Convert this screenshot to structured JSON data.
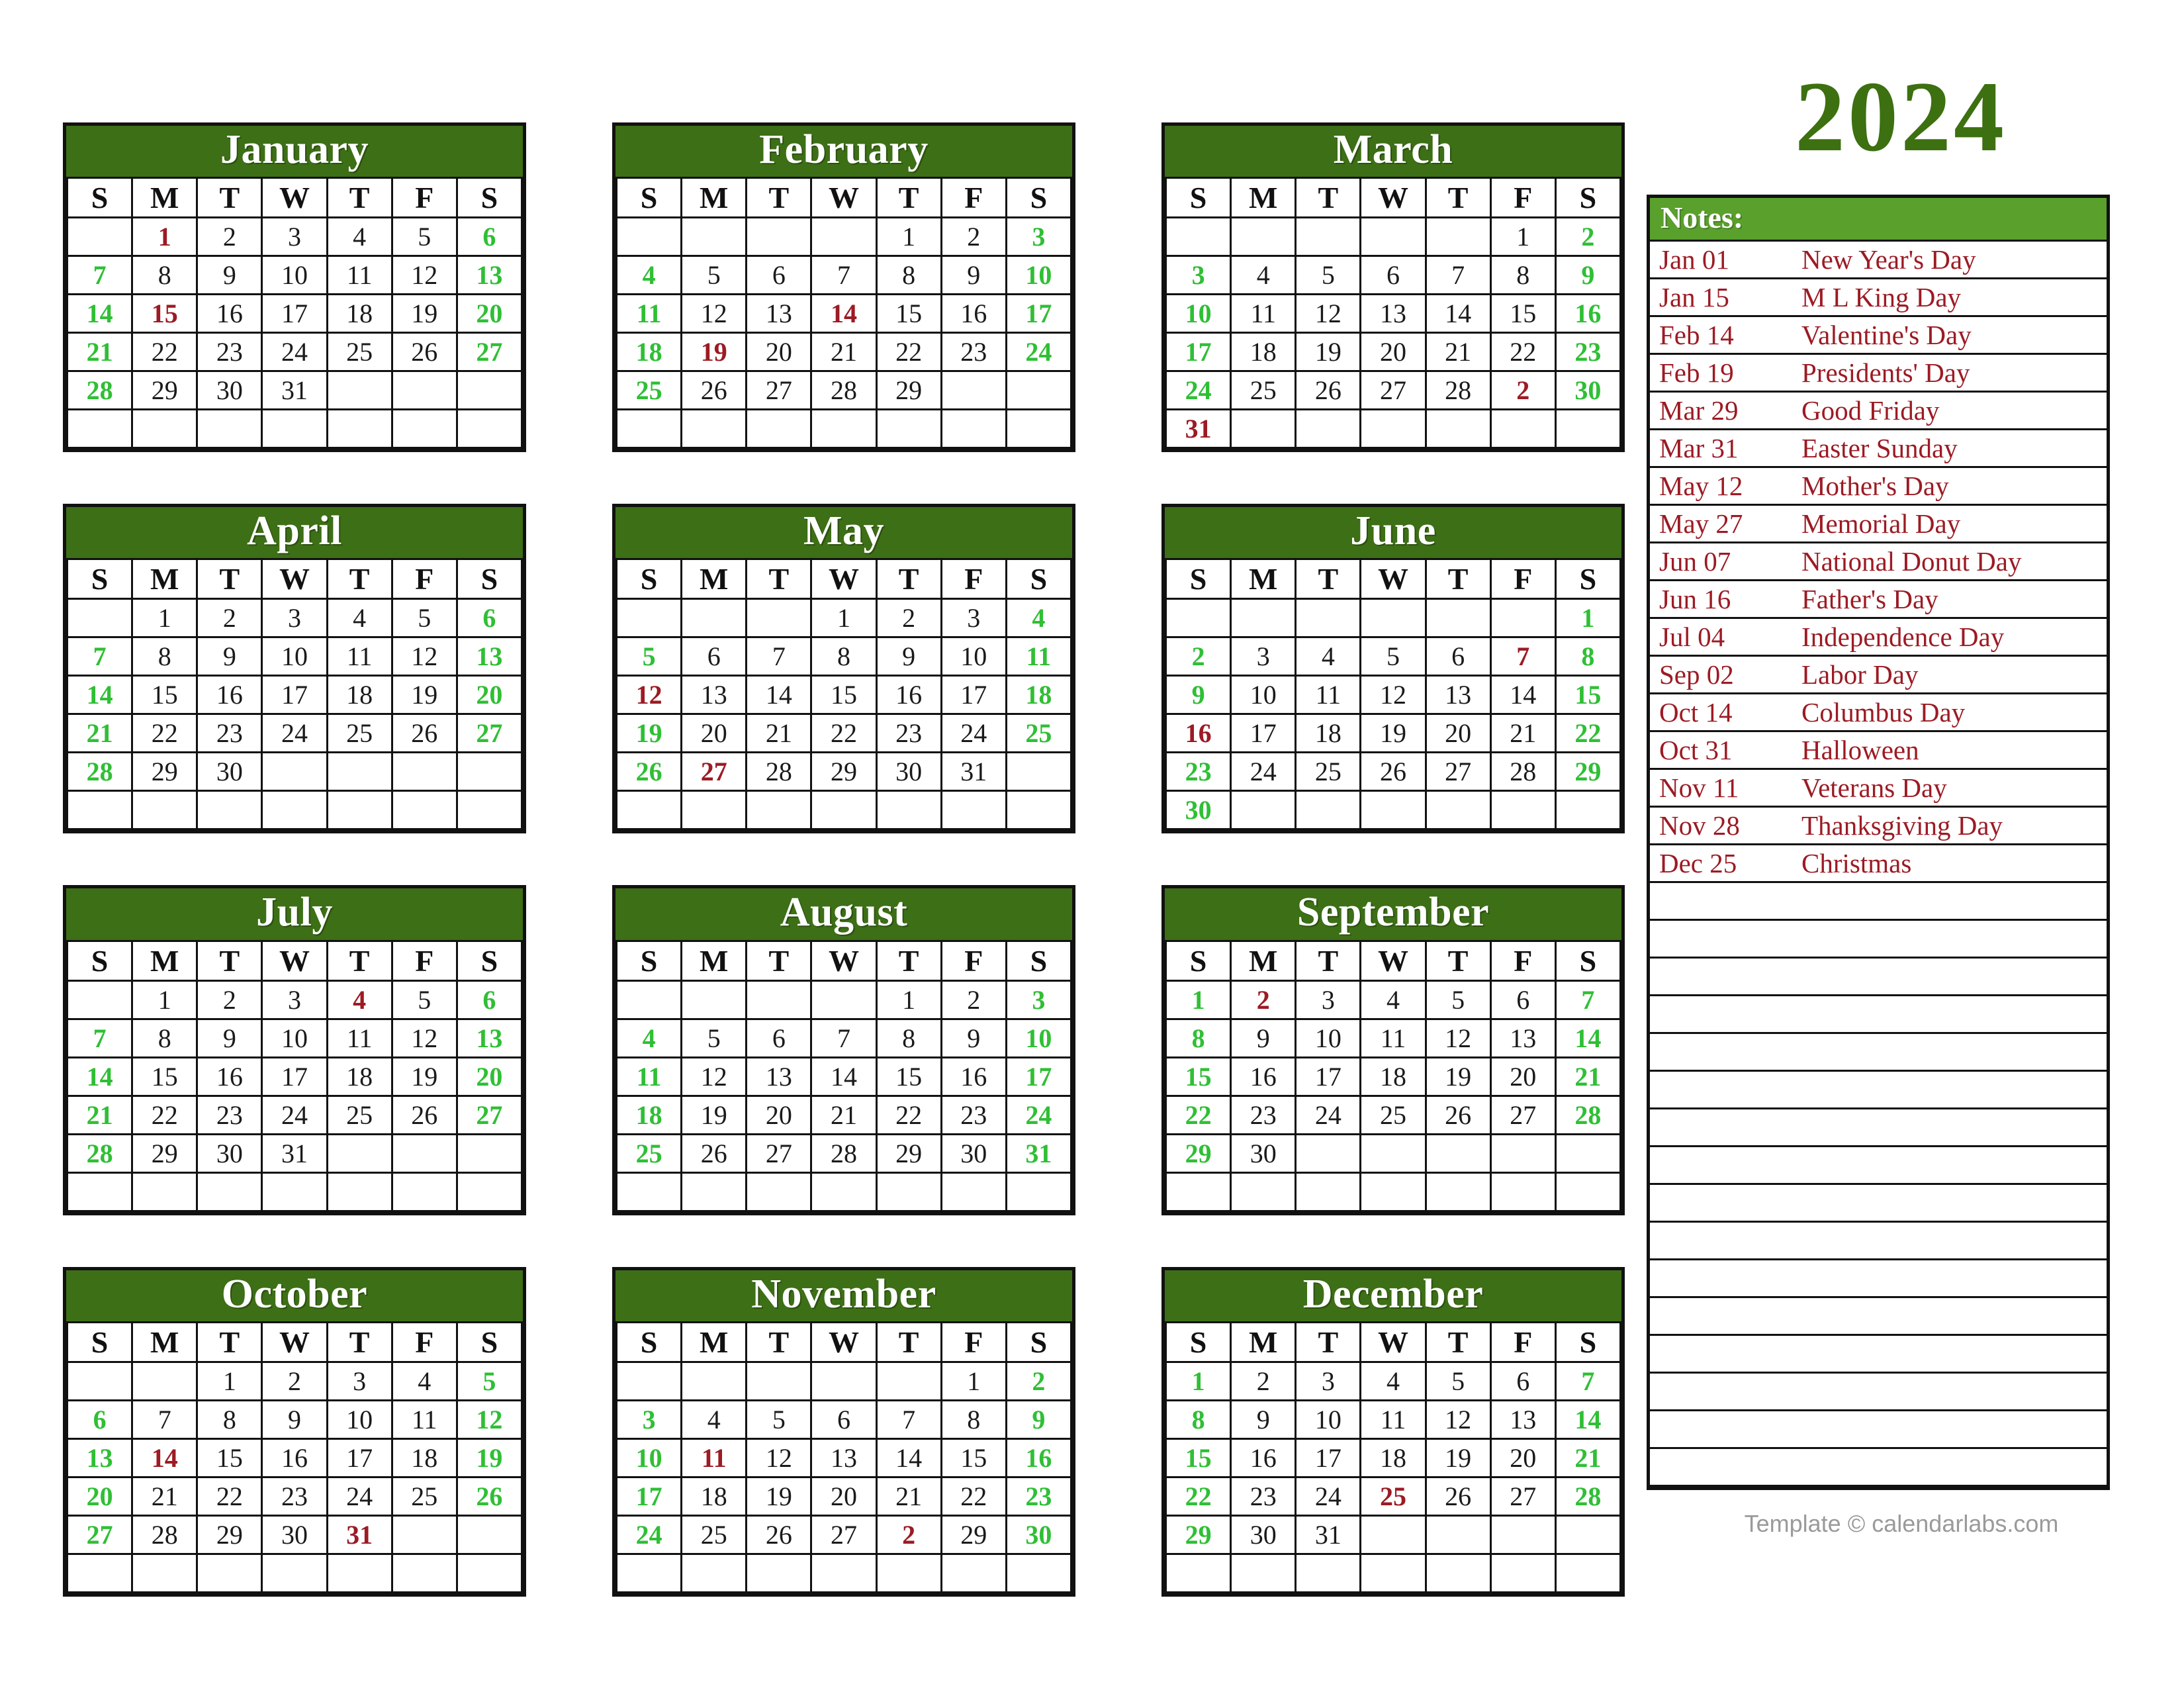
{
  "year_title": "2024",
  "footer": "Template © calendarlabs.com",
  "colors": {
    "month_header_green": "#3d6f16",
    "notes_header_green": "#5aa02c",
    "year_green": "#3d7010",
    "weekend_green": "#2fbf35",
    "holiday_red": "#9c1b24",
    "grid_black": "#111111"
  },
  "weekday_headers": [
    "S",
    "M",
    "T",
    "W",
    "T",
    "F",
    "S"
  ],
  "notes": {
    "header": "Notes:",
    "blank_rows": 16,
    "items": [
      {
        "date": "Jan 01",
        "label": "New Year's Day"
      },
      {
        "date": "Jan 15",
        "label": "M L King Day"
      },
      {
        "date": "Feb 14",
        "label": "Valentine's Day"
      },
      {
        "date": "Feb 19",
        "label": "Presidents' Day"
      },
      {
        "date": "Mar 29",
        "label": "Good Friday"
      },
      {
        "date": "Mar 31",
        "label": "Easter Sunday"
      },
      {
        "date": "May 12",
        "label": "Mother's Day"
      },
      {
        "date": "May 27",
        "label": "Memorial Day"
      },
      {
        "date": "Jun 07",
        "label": "National Donut Day"
      },
      {
        "date": "Jun 16",
        "label": "Father's Day"
      },
      {
        "date": "Jul 04",
        "label": "Independence Day"
      },
      {
        "date": "Sep 02",
        "label": "Labor Day"
      },
      {
        "date": "Oct 14",
        "label": "Columbus Day"
      },
      {
        "date": "Oct 31",
        "label": "Halloween"
      },
      {
        "date": "Nov 11",
        "label": "Veterans Day"
      },
      {
        "date": "Nov 28",
        "label": "Thanksgiving Day"
      },
      {
        "date": "Dec 25",
        "label": "Christmas"
      }
    ]
  },
  "months": [
    {
      "name": "January",
      "weeks": [
        [
          "",
          {
            "d": "1",
            "t": "holiday"
          },
          "2",
          "3",
          "4",
          "5",
          {
            "d": "6",
            "t": "weekend"
          }
        ],
        [
          {
            "d": "7",
            "t": "weekend"
          },
          "8",
          "9",
          "10",
          "11",
          "12",
          {
            "d": "13",
            "t": "weekend"
          }
        ],
        [
          {
            "d": "14",
            "t": "weekend"
          },
          {
            "d": "15",
            "t": "holiday"
          },
          "16",
          "17",
          "18",
          "19",
          {
            "d": "20",
            "t": "weekend"
          }
        ],
        [
          {
            "d": "21",
            "t": "weekend"
          },
          "22",
          "23",
          "24",
          "25",
          "26",
          {
            "d": "27",
            "t": "weekend"
          }
        ],
        [
          {
            "d": "28",
            "t": "weekend"
          },
          "29",
          "30",
          "31",
          "",
          "",
          ""
        ],
        [
          "",
          "",
          "",
          "",
          "",
          "",
          ""
        ]
      ]
    },
    {
      "name": "February",
      "weeks": [
        [
          "",
          "",
          "",
          "",
          "1",
          "2",
          {
            "d": "3",
            "t": "weekend"
          }
        ],
        [
          {
            "d": "4",
            "t": "weekend"
          },
          "5",
          "6",
          "7",
          "8",
          "9",
          {
            "d": "10",
            "t": "weekend"
          }
        ],
        [
          {
            "d": "11",
            "t": "weekend"
          },
          "12",
          "13",
          {
            "d": "14",
            "t": "holiday"
          },
          "15",
          "16",
          {
            "d": "17",
            "t": "weekend"
          }
        ],
        [
          {
            "d": "18",
            "t": "weekend"
          },
          {
            "d": "19",
            "t": "holiday"
          },
          "20",
          "21",
          "22",
          "23",
          {
            "d": "24",
            "t": "weekend"
          }
        ],
        [
          {
            "d": "25",
            "t": "weekend"
          },
          "26",
          "27",
          "28",
          "29",
          "",
          ""
        ],
        [
          "",
          "",
          "",
          "",
          "",
          "",
          ""
        ]
      ]
    },
    {
      "name": "March",
      "weeks": [
        [
          "",
          "",
          "",
          "",
          "",
          "1",
          {
            "d": "2",
            "t": "weekend"
          }
        ],
        [
          {
            "d": "3",
            "t": "weekend"
          },
          "4",
          "5",
          "6",
          "7",
          "8",
          {
            "d": "9",
            "t": "weekend"
          }
        ],
        [
          {
            "d": "10",
            "t": "weekend"
          },
          "11",
          "12",
          "13",
          "14",
          "15",
          {
            "d": "16",
            "t": "weekend"
          }
        ],
        [
          {
            "d": "17",
            "t": "weekend"
          },
          "18",
          "19",
          "20",
          "21",
          "22",
          {
            "d": "23",
            "t": "weekend"
          }
        ],
        [
          {
            "d": "24",
            "t": "weekend"
          },
          "25",
          "26",
          "27",
          "28",
          {
            "d": "2",
            "t": "holiday"
          },
          {
            "d": "30",
            "t": "weekend"
          }
        ],
        [
          {
            "d": "31",
            "t": "holiday"
          },
          "",
          "",
          "",
          "",
          "",
          ""
        ]
      ]
    },
    {
      "name": "April",
      "weeks": [
        [
          "",
          "1",
          "2",
          "3",
          "4",
          "5",
          {
            "d": "6",
            "t": "weekend"
          }
        ],
        [
          {
            "d": "7",
            "t": "weekend"
          },
          "8",
          "9",
          "10",
          "11",
          "12",
          {
            "d": "13",
            "t": "weekend"
          }
        ],
        [
          {
            "d": "14",
            "t": "weekend"
          },
          "15",
          "16",
          "17",
          "18",
          "19",
          {
            "d": "20",
            "t": "weekend"
          }
        ],
        [
          {
            "d": "21",
            "t": "weekend"
          },
          "22",
          "23",
          "24",
          "25",
          "26",
          {
            "d": "27",
            "t": "weekend"
          }
        ],
        [
          {
            "d": "28",
            "t": "weekend"
          },
          "29",
          "30",
          "",
          "",
          "",
          ""
        ],
        [
          "",
          "",
          "",
          "",
          "",
          "",
          ""
        ]
      ]
    },
    {
      "name": "May",
      "weeks": [
        [
          "",
          "",
          "",
          "1",
          "2",
          "3",
          {
            "d": "4",
            "t": "weekend"
          }
        ],
        [
          {
            "d": "5",
            "t": "weekend"
          },
          "6",
          "7",
          "8",
          "9",
          "10",
          {
            "d": "11",
            "t": "weekend"
          }
        ],
        [
          {
            "d": "12",
            "t": "holiday"
          },
          "13",
          "14",
          "15",
          "16",
          "17",
          {
            "d": "18",
            "t": "weekend"
          }
        ],
        [
          {
            "d": "19",
            "t": "weekend"
          },
          "20",
          "21",
          "22",
          "23",
          "24",
          {
            "d": "25",
            "t": "weekend"
          }
        ],
        [
          {
            "d": "26",
            "t": "weekend"
          },
          {
            "d": "27",
            "t": "holiday"
          },
          "28",
          "29",
          "30",
          "31",
          ""
        ],
        [
          "",
          "",
          "",
          "",
          "",
          "",
          ""
        ]
      ]
    },
    {
      "name": "June",
      "weeks": [
        [
          "",
          "",
          "",
          "",
          "",
          "",
          {
            "d": "1",
            "t": "weekend"
          }
        ],
        [
          {
            "d": "2",
            "t": "weekend"
          },
          "3",
          "4",
          "5",
          "6",
          {
            "d": "7",
            "t": "holiday"
          },
          {
            "d": "8",
            "t": "weekend"
          }
        ],
        [
          {
            "d": "9",
            "t": "weekend"
          },
          "10",
          "11",
          "12",
          "13",
          "14",
          {
            "d": "15",
            "t": "weekend"
          }
        ],
        [
          {
            "d": "16",
            "t": "holiday"
          },
          "17",
          "18",
          "19",
          "20",
          "21",
          {
            "d": "22",
            "t": "weekend"
          }
        ],
        [
          {
            "d": "23",
            "t": "weekend"
          },
          "24",
          "25",
          "26",
          "27",
          "28",
          {
            "d": "29",
            "t": "weekend"
          }
        ],
        [
          {
            "d": "30",
            "t": "weekend"
          },
          "",
          "",
          "",
          "",
          "",
          ""
        ]
      ]
    },
    {
      "name": "July",
      "weeks": [
        [
          "",
          "1",
          "2",
          "3",
          {
            "d": "4",
            "t": "holiday"
          },
          "5",
          {
            "d": "6",
            "t": "weekend"
          }
        ],
        [
          {
            "d": "7",
            "t": "weekend"
          },
          "8",
          "9",
          "10",
          "11",
          "12",
          {
            "d": "13",
            "t": "weekend"
          }
        ],
        [
          {
            "d": "14",
            "t": "weekend"
          },
          "15",
          "16",
          "17",
          "18",
          "19",
          {
            "d": "20",
            "t": "weekend"
          }
        ],
        [
          {
            "d": "21",
            "t": "weekend"
          },
          "22",
          "23",
          "24",
          "25",
          "26",
          {
            "d": "27",
            "t": "weekend"
          }
        ],
        [
          {
            "d": "28",
            "t": "weekend"
          },
          "29",
          "30",
          "31",
          "",
          "",
          ""
        ],
        [
          "",
          "",
          "",
          "",
          "",
          "",
          ""
        ]
      ]
    },
    {
      "name": "August",
      "weeks": [
        [
          "",
          "",
          "",
          "",
          "1",
          "2",
          {
            "d": "3",
            "t": "weekend"
          }
        ],
        [
          {
            "d": "4",
            "t": "weekend"
          },
          "5",
          "6",
          "7",
          "8",
          "9",
          {
            "d": "10",
            "t": "weekend"
          }
        ],
        [
          {
            "d": "11",
            "t": "weekend"
          },
          "12",
          "13",
          "14",
          "15",
          "16",
          {
            "d": "17",
            "t": "weekend"
          }
        ],
        [
          {
            "d": "18",
            "t": "weekend"
          },
          "19",
          "20",
          "21",
          "22",
          "23",
          {
            "d": "24",
            "t": "weekend"
          }
        ],
        [
          {
            "d": "25",
            "t": "weekend"
          },
          "26",
          "27",
          "28",
          "29",
          "30",
          {
            "d": "31",
            "t": "weekend"
          }
        ],
        [
          "",
          "",
          "",
          "",
          "",
          "",
          ""
        ]
      ]
    },
    {
      "name": "September",
      "weeks": [
        [
          {
            "d": "1",
            "t": "weekend"
          },
          {
            "d": "2",
            "t": "holiday"
          },
          "3",
          "4",
          "5",
          "6",
          {
            "d": "7",
            "t": "weekend"
          }
        ],
        [
          {
            "d": "8",
            "t": "weekend"
          },
          "9",
          "10",
          "11",
          "12",
          "13",
          {
            "d": "14",
            "t": "weekend"
          }
        ],
        [
          {
            "d": "15",
            "t": "weekend"
          },
          "16",
          "17",
          "18",
          "19",
          "20",
          {
            "d": "21",
            "t": "weekend"
          }
        ],
        [
          {
            "d": "22",
            "t": "weekend"
          },
          "23",
          "24",
          "25",
          "26",
          "27",
          {
            "d": "28",
            "t": "weekend"
          }
        ],
        [
          {
            "d": "29",
            "t": "weekend"
          },
          "30",
          "",
          "",
          "",
          "",
          ""
        ],
        [
          "",
          "",
          "",
          "",
          "",
          "",
          ""
        ]
      ]
    },
    {
      "name": "October",
      "weeks": [
        [
          "",
          "",
          "1",
          "2",
          "3",
          "4",
          {
            "d": "5",
            "t": "weekend"
          }
        ],
        [
          {
            "d": "6",
            "t": "weekend"
          },
          "7",
          "8",
          "9",
          "10",
          "11",
          {
            "d": "12",
            "t": "weekend"
          }
        ],
        [
          {
            "d": "13",
            "t": "weekend"
          },
          {
            "d": "14",
            "t": "holiday"
          },
          "15",
          "16",
          "17",
          "18",
          {
            "d": "19",
            "t": "weekend"
          }
        ],
        [
          {
            "d": "20",
            "t": "weekend"
          },
          "21",
          "22",
          "23",
          "24",
          "25",
          {
            "d": "26",
            "t": "weekend"
          }
        ],
        [
          {
            "d": "27",
            "t": "weekend"
          },
          "28",
          "29",
          "30",
          {
            "d": "31",
            "t": "holiday"
          },
          "",
          ""
        ],
        [
          "",
          "",
          "",
          "",
          "",
          "",
          ""
        ]
      ]
    },
    {
      "name": "November",
      "weeks": [
        [
          "",
          "",
          "",
          "",
          "",
          "1",
          {
            "d": "2",
            "t": "weekend"
          }
        ],
        [
          {
            "d": "3",
            "t": "weekend"
          },
          "4",
          "5",
          "6",
          "7",
          "8",
          {
            "d": "9",
            "t": "weekend"
          }
        ],
        [
          {
            "d": "10",
            "t": "weekend"
          },
          {
            "d": "11",
            "t": "holiday"
          },
          "12",
          "13",
          "14",
          "15",
          {
            "d": "16",
            "t": "weekend"
          }
        ],
        [
          {
            "d": "17",
            "t": "weekend"
          },
          "18",
          "19",
          "20",
          "21",
          "22",
          {
            "d": "23",
            "t": "weekend"
          }
        ],
        [
          {
            "d": "24",
            "t": "weekend"
          },
          "25",
          "26",
          "27",
          {
            "d": "2",
            "t": "holiday"
          },
          "29",
          {
            "d": "30",
            "t": "weekend"
          }
        ],
        [
          "",
          "",
          "",
          "",
          "",
          "",
          ""
        ]
      ]
    },
    {
      "name": "December",
      "weeks": [
        [
          {
            "d": "1",
            "t": "weekend"
          },
          "2",
          "3",
          "4",
          "5",
          "6",
          {
            "d": "7",
            "t": "weekend"
          }
        ],
        [
          {
            "d": "8",
            "t": "weekend"
          },
          "9",
          "10",
          "11",
          "12",
          "13",
          {
            "d": "14",
            "t": "weekend"
          }
        ],
        [
          {
            "d": "15",
            "t": "weekend"
          },
          "16",
          "17",
          "18",
          "19",
          "20",
          {
            "d": "21",
            "t": "weekend"
          }
        ],
        [
          {
            "d": "22",
            "t": "weekend"
          },
          "23",
          "24",
          {
            "d": "25",
            "t": "holiday"
          },
          "26",
          "27",
          {
            "d": "28",
            "t": "weekend"
          }
        ],
        [
          {
            "d": "29",
            "t": "weekend"
          },
          "30",
          "31",
          "",
          "",
          "",
          ""
        ],
        [
          "",
          "",
          "",
          "",
          "",
          "",
          ""
        ]
      ]
    }
  ]
}
